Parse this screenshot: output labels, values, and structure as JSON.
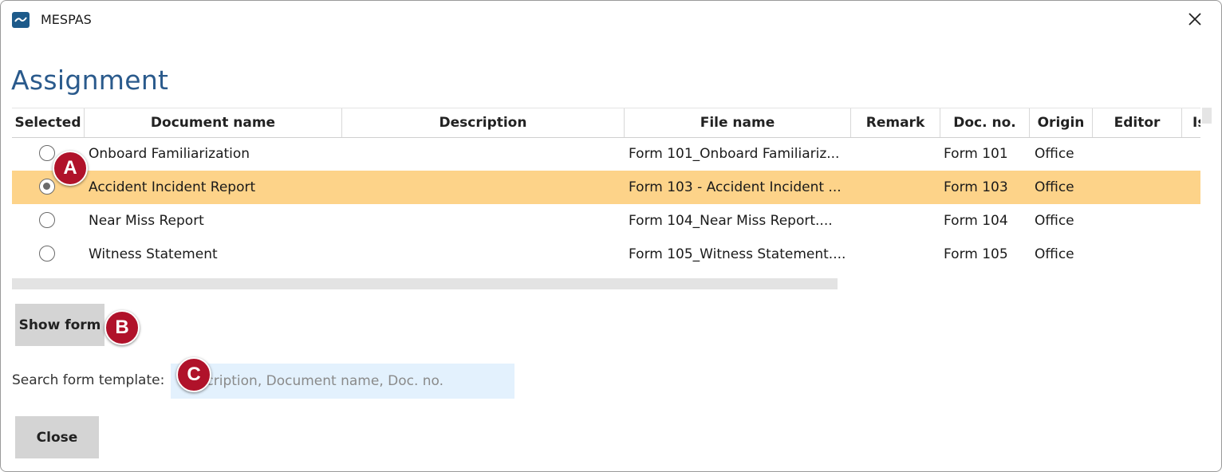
{
  "window": {
    "title": "MESPAS"
  },
  "page": {
    "heading": "Assignment"
  },
  "table": {
    "columns": [
      "Selected",
      "Document name",
      "Description",
      "File name",
      "Remark",
      "Doc. no.",
      "Origin",
      "Editor",
      "Is"
    ],
    "rows": [
      {
        "selected": false,
        "document_name": "Onboard Familiarization",
        "description": "",
        "file_name": "Form 101_Onboard Familiariz...",
        "remark": "",
        "doc_no": "Form 101",
        "origin": "Office",
        "editor": ""
      },
      {
        "selected": true,
        "document_name": "Accident Incident Report",
        "description": "",
        "file_name": "Form 103 - Accident Incident ...",
        "remark": "",
        "doc_no": "Form 103",
        "origin": "Office",
        "editor": ""
      },
      {
        "selected": false,
        "document_name": "Near Miss Report",
        "description": "",
        "file_name": "Form 104_Near Miss Report....",
        "remark": "",
        "doc_no": "Form 104",
        "origin": "Office",
        "editor": ""
      },
      {
        "selected": false,
        "document_name": "Witness Statement",
        "description": "",
        "file_name": "Form 105_Witness Statement....",
        "remark": "",
        "doc_no": "Form 105",
        "origin": "Office",
        "editor": ""
      }
    ]
  },
  "buttons": {
    "show_form": "Show form",
    "close": "Close"
  },
  "search": {
    "label": "Search form template:",
    "placeholder": "Description, Document name, Doc. no.",
    "value": ""
  },
  "markers": [
    "A",
    "B",
    "C"
  ],
  "colors": {
    "selected_row": "#fdd389",
    "heading": "#2a5a8c",
    "marker": "#b0122a",
    "search_bg": "#e3f1fd"
  }
}
